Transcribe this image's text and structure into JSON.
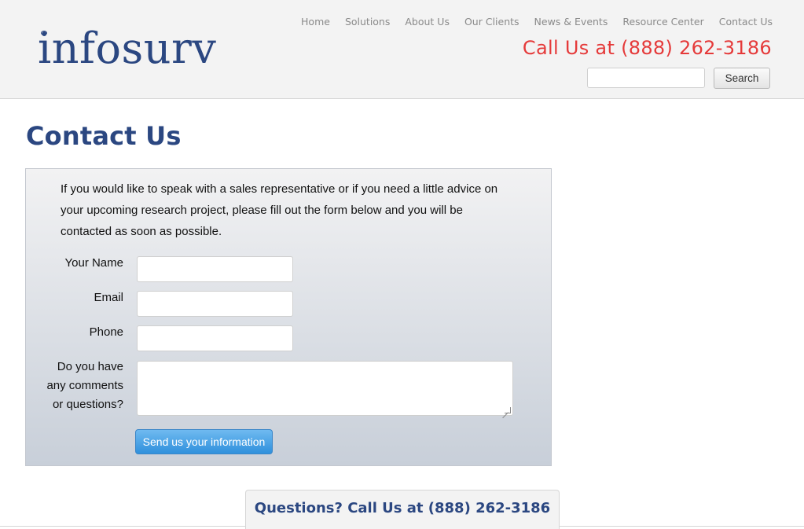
{
  "header": {
    "logo_text": "infosurv",
    "nav": [
      "Home",
      "Solutions",
      "About Us",
      "Our Clients",
      "News & Events",
      "Resource Center",
      "Contact Us"
    ],
    "phone": "Call Us at (888) 262-3186",
    "search": {
      "value": "",
      "button_label": "Search"
    }
  },
  "main": {
    "title": "Contact Us",
    "intro": "If you would like to speak with a sales representative or if you need a little advice on your upcoming research project, please fill out the form below and you will be contacted as soon as possible.",
    "form": {
      "name_label": "Your Name",
      "email_label": "Email",
      "phone_label": "Phone",
      "comments_label_1": "Do you have",
      "comments_label_2": "any comments",
      "comments_label_3": "or questions?",
      "submit_label": "Send us your information"
    }
  },
  "footer_tab": {
    "text": "Questions? Call Us at (888) 262-3186"
  },
  "colors": {
    "brand_blue": "#2b4781",
    "phone_red": "#e53a3a",
    "button_blue": "#2f90dc"
  }
}
